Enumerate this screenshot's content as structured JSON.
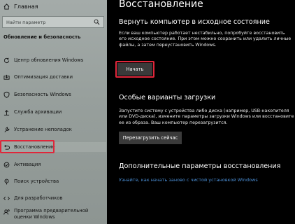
{
  "sidebar": {
    "home_label": "Главная",
    "search_placeholder": "Найти параметр",
    "section_title": "Обновление и безопасность",
    "items": [
      {
        "label": "Центр обновления Windows",
        "icon": "refresh-icon"
      },
      {
        "label": "Оптимизация доставки",
        "icon": "delivery-icon"
      },
      {
        "label": "Безопасность Windows",
        "icon": "shield-icon"
      },
      {
        "label": "Служба архивации",
        "icon": "backup-icon"
      },
      {
        "label": "Устранение неполадок",
        "icon": "wrench-icon"
      },
      {
        "label": "Восстановление",
        "icon": "recovery-icon",
        "selected": true
      },
      {
        "label": "Активация",
        "icon": "activation-icon"
      },
      {
        "label": "Поиск устройства",
        "icon": "locate-icon"
      },
      {
        "label": "Для разработчиков",
        "icon": "developer-icon"
      },
      {
        "label": "Программа предварительной оценки Windows",
        "icon": "insider-icon"
      }
    ]
  },
  "main": {
    "title": "Восстановление",
    "reset": {
      "heading": "Вернуть компьютер в исходное состояние",
      "description": "Если ваш компьютер работает нестабильно, попробуйте восстановить его исходное состояние. При этом можно сохранить или удалить личные файлы, а затем переустановить Windows.",
      "button_label": "Начать"
    },
    "advanced_boot": {
      "heading": "Особые варианты загрузки",
      "description": "Запустите систему с устройства либо диска (например, USB-накопителя или DVD-диска), измените параметры загрузки Windows или восстановите ее из образа. Ваш компьютер перезагрузится.",
      "button_label": "Перезагрузить сейчас"
    },
    "more": {
      "heading": "Дополнительные параметры восстановления",
      "link": "Узнайте, как начать заново с чистой установкой Windows"
    }
  },
  "colors": {
    "highlight_border": "#e0263a",
    "link": "#4b8fd6",
    "button_bg": "#3a3a3a"
  }
}
